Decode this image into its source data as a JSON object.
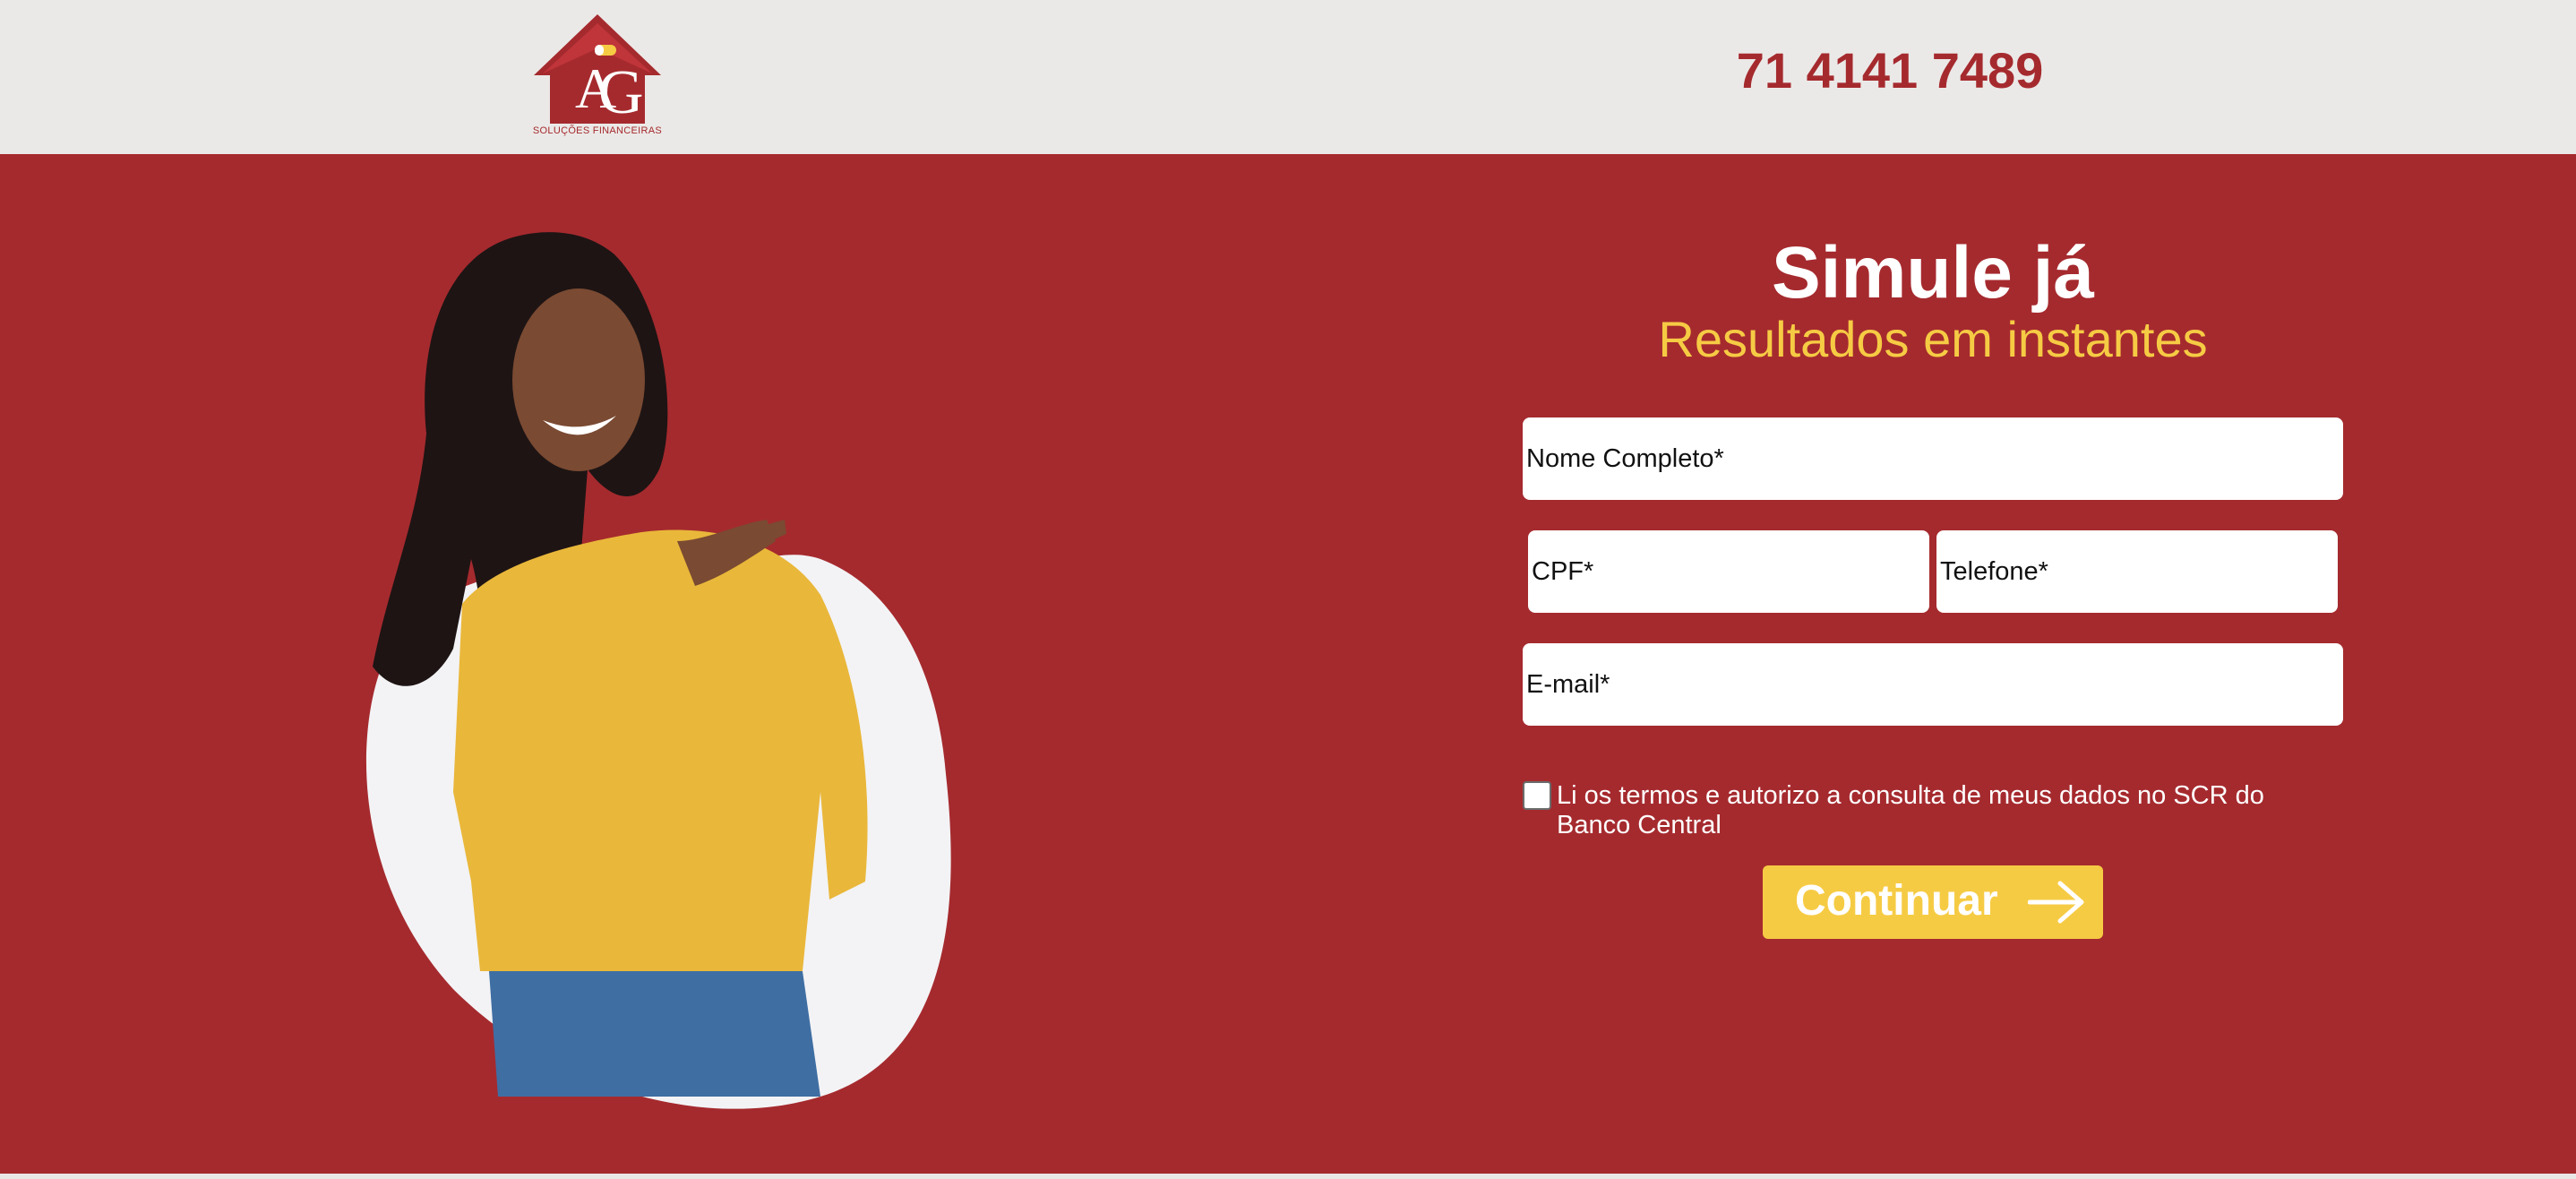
{
  "header": {
    "logo_letters": "AG",
    "logo_tagline": "SOLUÇÕES FINANCEIRAS",
    "phone": "71 4141 7489"
  },
  "hero": {
    "title": "Simule já",
    "subtitle": "Resultados em instantes"
  },
  "form": {
    "name_placeholder": "Nome Completo*",
    "cpf_placeholder": "CPF*",
    "phone_placeholder": "Telefone*",
    "email_placeholder": "E-mail*",
    "consent_text": "Li os termos e autorizo a consulta de meus dados no SCR do Banco Central",
    "submit_label": "Continuar",
    "submit_icon": "arrow-right-icon"
  },
  "colors": {
    "brand_red": "#a52a2e",
    "accent_yellow": "#f6cb44",
    "header_bg": "#ebe9e7"
  }
}
